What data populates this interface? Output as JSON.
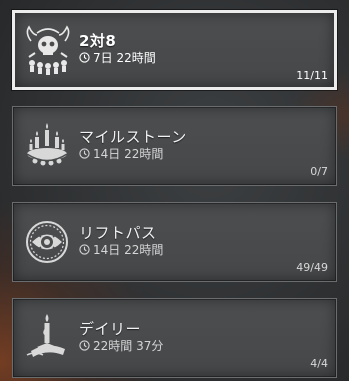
{
  "cards": [
    {
      "title": "2対8",
      "timer": "7日 22時間",
      "progress": "11/11",
      "icon": "skull-emblem-icon",
      "selected": true
    },
    {
      "title": "マイルストーン",
      "timer": "14日 22時間",
      "progress": "0/7",
      "icon": "candles-icon",
      "selected": false
    },
    {
      "title": "リフトパス",
      "timer": "14日 22時間",
      "progress": "49/49",
      "icon": "rift-eye-icon",
      "selected": false
    },
    {
      "title": "デイリー",
      "timer": "22時間 37分",
      "progress": "4/4",
      "icon": "candle-icon",
      "selected": false
    }
  ],
  "colors": {
    "selected_border": "#ececec",
    "card_bg": "#4a4c4e",
    "text": "#f2f2f2"
  }
}
